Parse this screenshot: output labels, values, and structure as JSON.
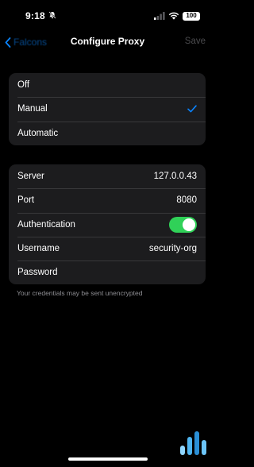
{
  "status_bar": {
    "time": "9:18",
    "battery": "100",
    "icons": [
      "bell-slash-icon",
      "cellular-signal-icon",
      "wifi-icon",
      "battery-icon"
    ]
  },
  "nav": {
    "back_label": "Falcons",
    "title": "Configure Proxy",
    "save_label": "Save",
    "icons": [
      "chevron-left-icon"
    ]
  },
  "mode": {
    "options": [
      {
        "label": "Off",
        "selected": false
      },
      {
        "label": "Manual",
        "selected": true
      },
      {
        "label": "Automatic",
        "selected": false
      }
    ]
  },
  "server_config": {
    "server_label": "Server",
    "server_value": "127.0.0.43",
    "port_label": "Port",
    "port_value": "8080",
    "auth_label": "Authentication",
    "auth_enabled": true,
    "username_label": "Username",
    "username_value": "security-org",
    "password_label": "Password"
  },
  "footnote": "Your credentials may be sent unencrypted",
  "colors": {
    "background": "#000000",
    "group_background": "#1c1c1e",
    "accent": "#0a84ff",
    "toggle_on": "#30d158",
    "secondary_text": "#8e8e93"
  },
  "logo_icon": "security-org-logo-icon"
}
